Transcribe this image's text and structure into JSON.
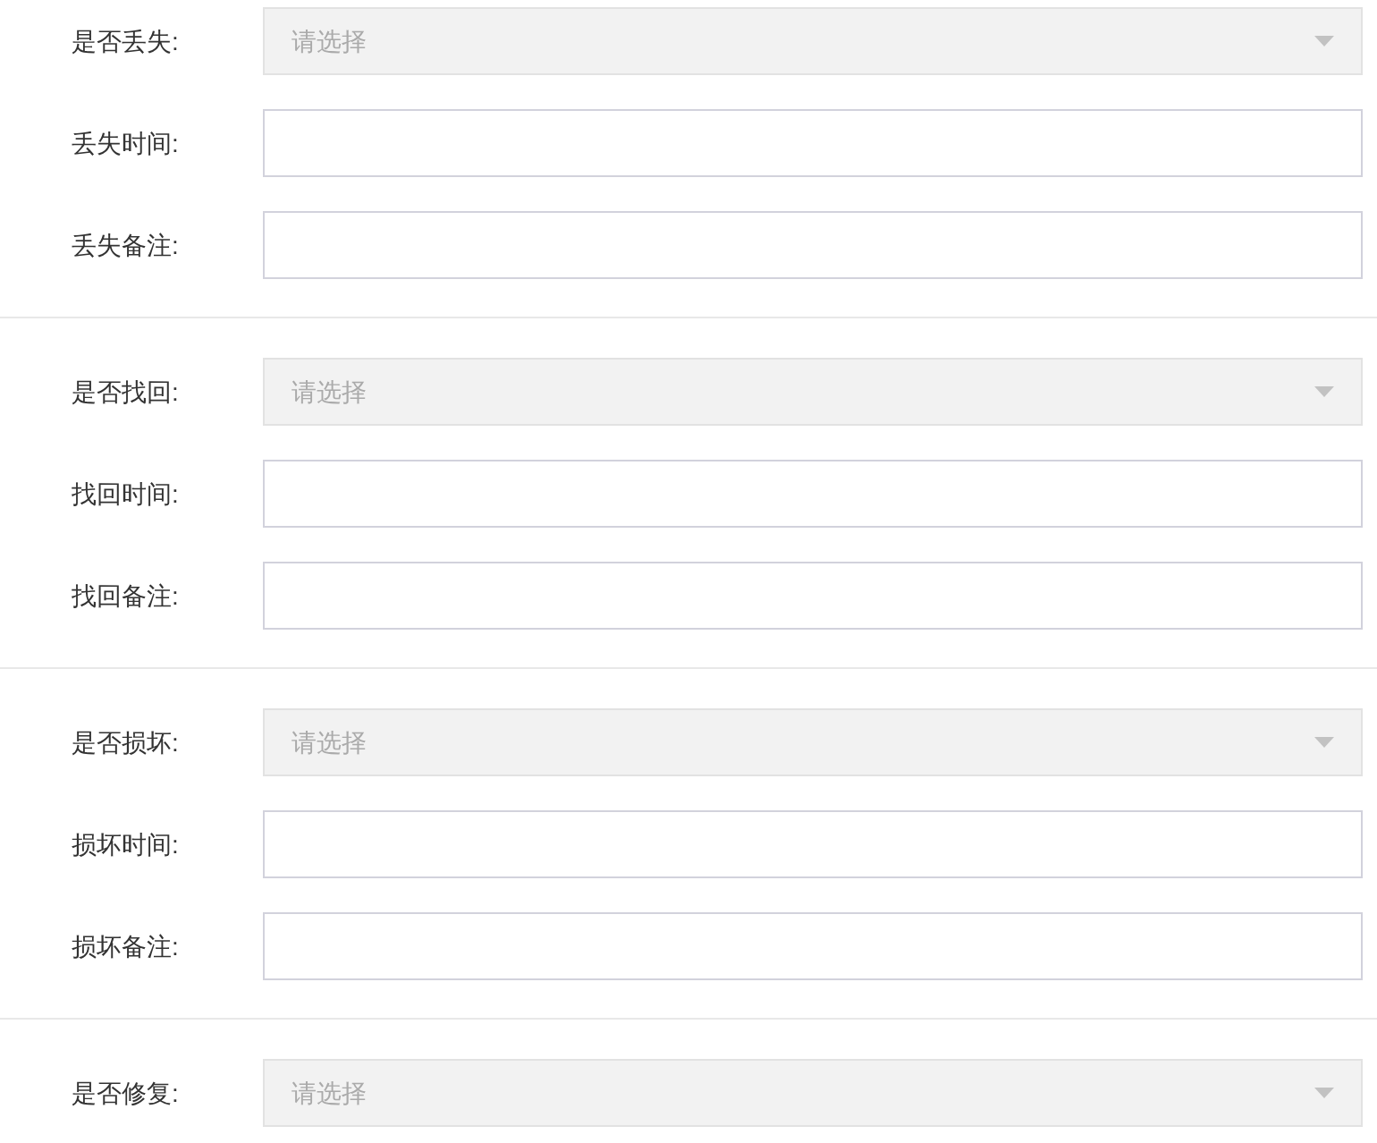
{
  "sections": [
    {
      "fields": [
        {
          "label": "是否丢失:",
          "kind": "select",
          "placeholder": "请选择",
          "disabled": true
        },
        {
          "label": "丢失时间:",
          "kind": "input",
          "disabled": false
        },
        {
          "label": "丢失备注:",
          "kind": "input",
          "disabled": false
        }
      ]
    },
    {
      "fields": [
        {
          "label": "是否找回:",
          "kind": "select",
          "placeholder": "请选择",
          "disabled": true
        },
        {
          "label": "找回时间:",
          "kind": "input",
          "disabled": false
        },
        {
          "label": "找回备注:",
          "kind": "input",
          "disabled": false
        }
      ]
    },
    {
      "fields": [
        {
          "label": "是否损坏:",
          "kind": "select",
          "placeholder": "请选择",
          "disabled": true
        },
        {
          "label": "损坏时间:",
          "kind": "input",
          "disabled": false
        },
        {
          "label": "损坏备注:",
          "kind": "input",
          "disabled": false
        }
      ]
    },
    {
      "fields": [
        {
          "label": "是否修复:",
          "kind": "select",
          "placeholder": "请选择",
          "disabled": true
        }
      ]
    }
  ]
}
